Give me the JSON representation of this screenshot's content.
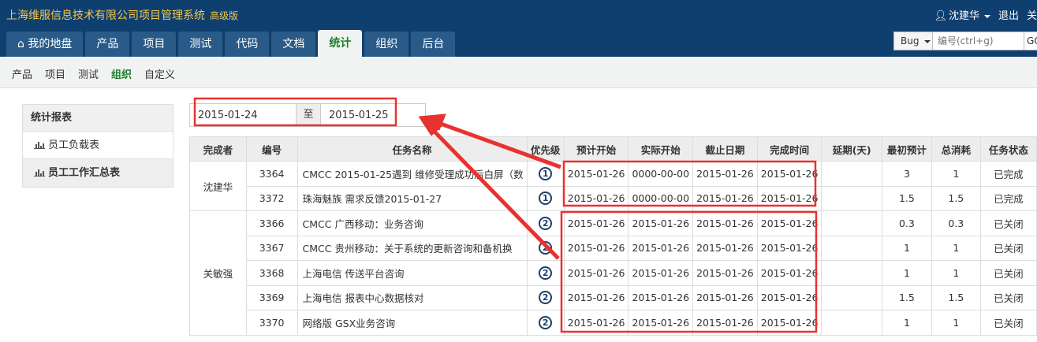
{
  "header": {
    "brand": "上海维服信息技术有限公司项目管理系统",
    "edition": "高级版",
    "user": "沈建华",
    "logout": "退出",
    "more": "关"
  },
  "nav": {
    "tabs": [
      {
        "label": "我的地盘"
      },
      {
        "label": "产品"
      },
      {
        "label": "项目"
      },
      {
        "label": "测试"
      },
      {
        "label": "代码"
      },
      {
        "label": "文档"
      },
      {
        "label": "统计"
      },
      {
        "label": "组织"
      },
      {
        "label": "后台"
      }
    ],
    "active_index": 6
  },
  "search": {
    "type": "Bug",
    "placeholder": "编号(ctrl+g)",
    "go": "GO"
  },
  "subnav": {
    "items": [
      {
        "label": "产品"
      },
      {
        "label": "项目"
      },
      {
        "label": "测试"
      },
      {
        "label": "组织"
      },
      {
        "label": "自定义"
      }
    ],
    "active_index": 3
  },
  "sidebar": {
    "title": "统计报表",
    "items": [
      {
        "label": "员工负载表"
      },
      {
        "label": "员工工作汇总表"
      }
    ],
    "active_index": 1
  },
  "date_range": {
    "from": "2015-01-24",
    "separator": "至",
    "to": "2015-01-25"
  },
  "table": {
    "columns": [
      "完成者",
      "编号",
      "任务名称",
      "优先级",
      "预计开始",
      "实际开始",
      "截止日期",
      "完成时间",
      "延期(天)",
      "最初预计",
      "总消耗",
      "任务状态"
    ],
    "groups": [
      {
        "owner": "沈建华",
        "rows": [
          {
            "id": "3364",
            "name": "CMCC 2015-01-25遇到 维修受理成功后白屏（数",
            "priority": "1",
            "plan_start": "2015-01-26",
            "real_start": "0000-00-00",
            "deadline": "2015-01-26",
            "finished": "2015-01-26",
            "delay": "",
            "estimate": "3",
            "consumed": "1",
            "status": "已完成"
          },
          {
            "id": "3372",
            "name": "珠海魅族 需求反馈2015-01-27",
            "priority": "1",
            "plan_start": "2015-01-26",
            "real_start": "0000-00-00",
            "deadline": "2015-01-26",
            "finished": "2015-01-26",
            "delay": "",
            "estimate": "1.5",
            "consumed": "1.5",
            "status": "已完成"
          }
        ]
      },
      {
        "owner": "关敏强",
        "rows": [
          {
            "id": "3366",
            "name": "CMCC 广西移动：业务咨询",
            "priority": "2",
            "plan_start": "2015-01-26",
            "real_start": "2015-01-26",
            "deadline": "2015-01-26",
            "finished": "2015-01-26",
            "delay": "",
            "estimate": "0.3",
            "consumed": "0.3",
            "status": "已关闭"
          },
          {
            "id": "3367",
            "name": "CMCC 贵州移动：关于系统的更新咨询和备机换",
            "priority": "2",
            "plan_start": "2015-01-26",
            "real_start": "2015-01-26",
            "deadline": "2015-01-26",
            "finished": "2015-01-26",
            "delay": "",
            "estimate": "1",
            "consumed": "1",
            "status": "已关闭"
          },
          {
            "id": "3368",
            "name": "上海电信 传送平台咨询",
            "priority": "2",
            "plan_start": "2015-01-26",
            "real_start": "2015-01-26",
            "deadline": "2015-01-26",
            "finished": "2015-01-26",
            "delay": "",
            "estimate": "1",
            "consumed": "1",
            "status": "已关闭"
          },
          {
            "id": "3369",
            "name": "上海电信 报表中心数据核对",
            "priority": "2",
            "plan_start": "2015-01-26",
            "real_start": "2015-01-26",
            "deadline": "2015-01-26",
            "finished": "2015-01-26",
            "delay": "",
            "estimate": "1.5",
            "consumed": "1.5",
            "status": "已关闭"
          },
          {
            "id": "3370",
            "name": "网络版 GSX业务咨询",
            "priority": "2",
            "plan_start": "2015-01-26",
            "real_start": "2015-01-26",
            "deadline": "2015-01-26",
            "finished": "2015-01-26",
            "delay": "",
            "estimate": "1",
            "consumed": "1",
            "status": "已关闭"
          }
        ]
      }
    ]
  },
  "colors": {
    "header_bg": "#0f3f6f",
    "tab_bg": "#2a5a88",
    "active_green": "#1f7f2a",
    "brand_yellow": "#f3c64a",
    "annotation_red": "#e8322f"
  }
}
